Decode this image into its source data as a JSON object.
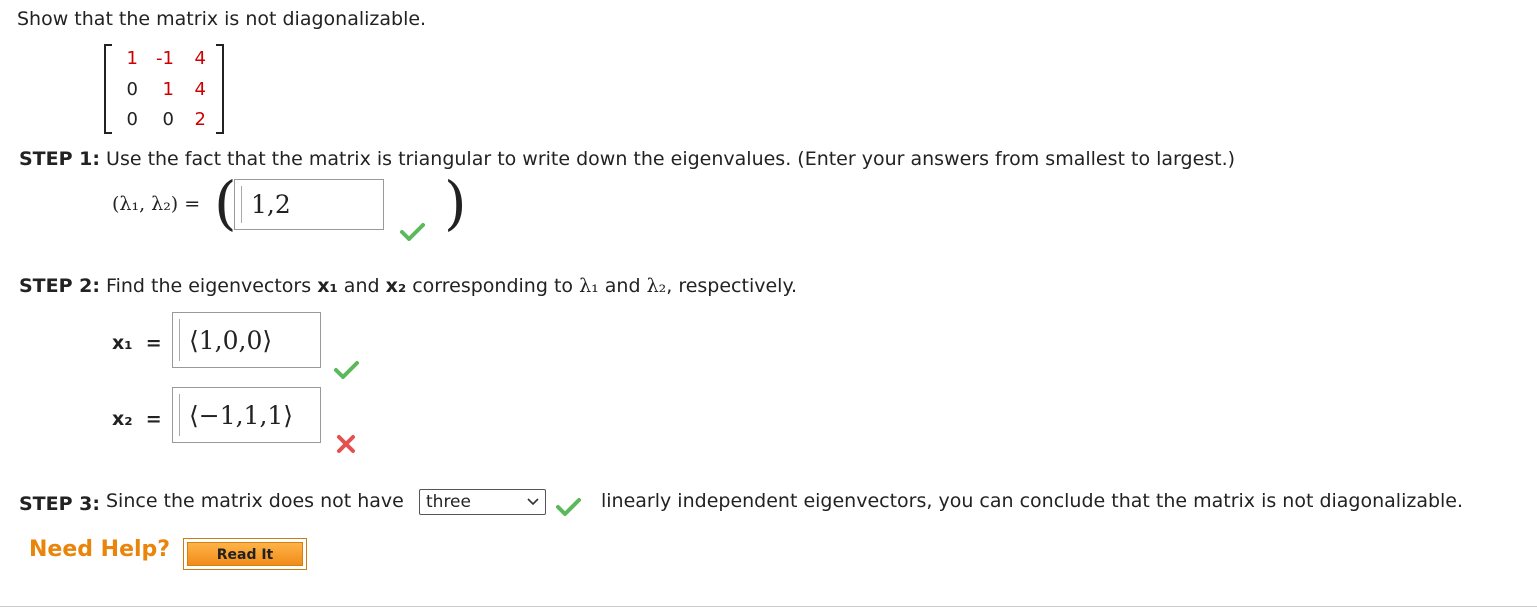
{
  "prompt": "Show that the matrix is not diagonalizable.",
  "matrix": [
    [
      "1",
      "-1",
      "4"
    ],
    [
      "0",
      "1",
      "4"
    ],
    [
      "0",
      "0",
      "2"
    ]
  ],
  "step1": {
    "label": "STEP 1:",
    "text": "Use the fact that the matrix is triangular to write down the eigenvalues. (Enter your answers from smallest to largest.)",
    "lhs": "(λ₁, λ₂) =",
    "answer": "1,2",
    "status": "correct"
  },
  "step2": {
    "label": "STEP 2:",
    "text_1": "Find the eigenvectors ",
    "x1_sym": "x₁",
    "text_2": " and ",
    "x2_sym": "x₂",
    "text_3": " corresponding to ",
    "l1": "λ₁",
    "text_4": " and ",
    "l2": "λ₂",
    "text_5": ", respectively.",
    "x1_lhs": "x₁  =",
    "x1_answer": "⟨1,0,0⟩",
    "x1_status": "correct",
    "x2_lhs": "x₂  =",
    "x2_answer": "⟨−1,1,1⟩",
    "x2_status": "incorrect"
  },
  "step3": {
    "label": "STEP 3:",
    "before": "Since the matrix does not have",
    "select_value": "three",
    "select_status": "correct",
    "after": "linearly independent eigenvectors, you can conclude that the matrix is not diagonalizable."
  },
  "help": {
    "label": "Need Help?",
    "read_it": "Read It"
  },
  "colors": {
    "correct": "#5cb85c",
    "incorrect": "#e35050",
    "help": "#e8850a",
    "matrix_entry": "#cc0000"
  }
}
